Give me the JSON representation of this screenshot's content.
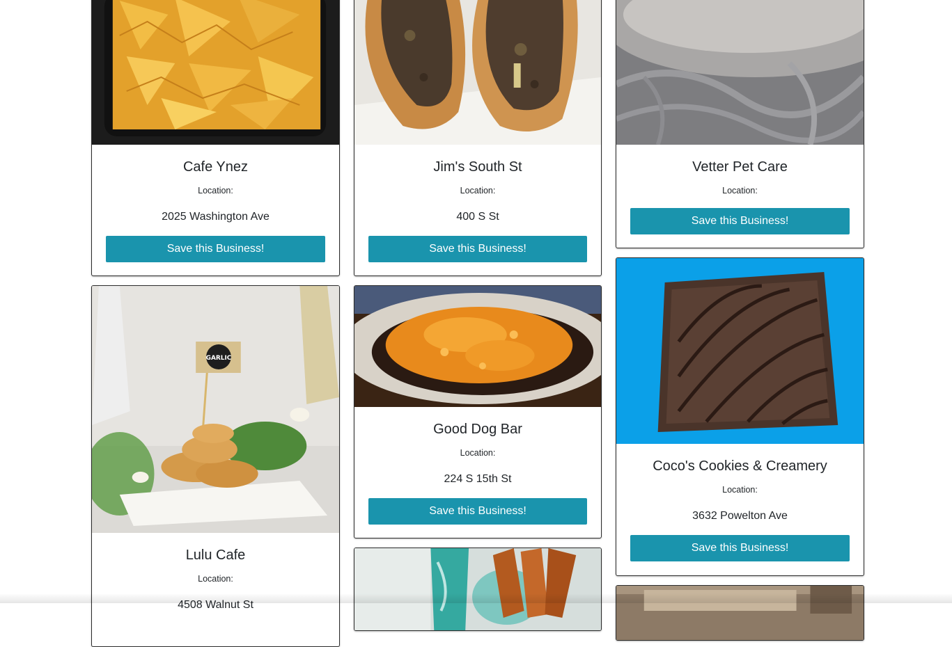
{
  "labels": {
    "location": "Location:",
    "save_button": "Save this Business!"
  },
  "businesses": [
    {
      "name": "Cafe Ynez",
      "address": "2025 Washington Ave",
      "photo": "tortilla-chips-photo"
    },
    {
      "name": "Jim's South St",
      "address": "400 S St",
      "photo": "cheesesteak-photo"
    },
    {
      "name": "Vetter Pet Care",
      "address": "",
      "photo": "pet-fur-photo"
    },
    {
      "name": "Lulu Cafe",
      "address": "4508 Walnut St",
      "photo": "garlic-chicken-photo"
    },
    {
      "name": "Good Dog Bar",
      "address": "224 S 15th St",
      "photo": "mac-and-cheese-photo"
    },
    {
      "name": "Coco's Cookies & Creamery",
      "address": "3632 Powelton Ave",
      "photo": "brownie-photo"
    }
  ],
  "images": {
    "garlic_flag_text": "GARLIC"
  },
  "colors": {
    "button": "#1a94ad",
    "button_text": "#ffffff",
    "card_border": "#2b2b2b",
    "brownie_background": "#0ba0e8"
  }
}
